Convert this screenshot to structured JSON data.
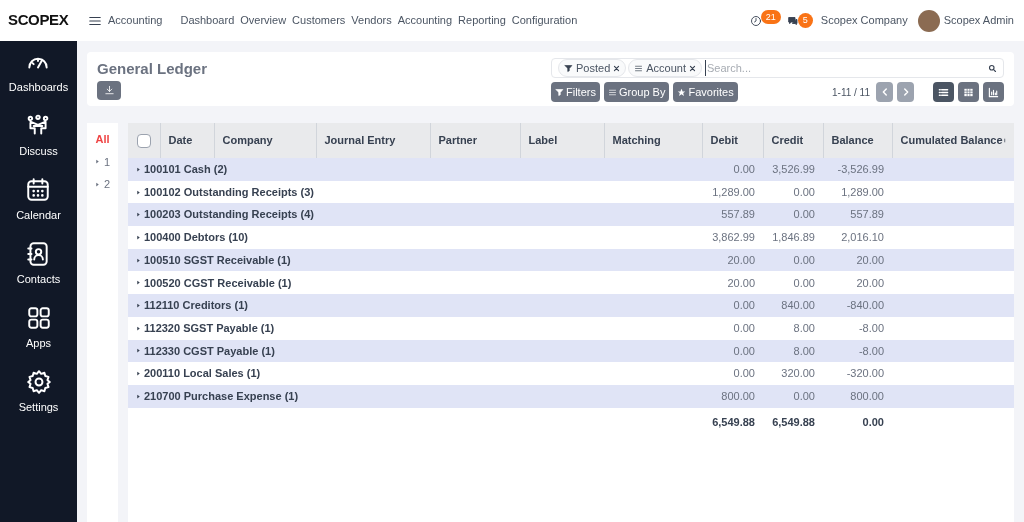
{
  "topbar": {
    "logo": "SCOPEX",
    "app": "Accounting",
    "menu": [
      "Dashboard",
      "Overview",
      "Customers",
      "Vendors",
      "Accounting",
      "Reporting",
      "Configuration"
    ],
    "activity_count": "21",
    "message_count": "5",
    "company": "Scopex Company",
    "user": "Scopex Admin"
  },
  "sidebar": {
    "items": [
      {
        "kind": "dashboards",
        "label": "Dashboards"
      },
      {
        "kind": "discuss",
        "label": "Discuss"
      },
      {
        "kind": "calendar",
        "label": "Calendar"
      },
      {
        "kind": "contacts",
        "label": "Contacts"
      },
      {
        "kind": "apps",
        "label": "Apps"
      },
      {
        "kind": "settings",
        "label": "Settings"
      }
    ]
  },
  "control_panel": {
    "title": "General Ledger",
    "facets": [
      {
        "kind": "filter",
        "label": "Posted"
      },
      {
        "kind": "group",
        "label": "Account"
      }
    ],
    "search": {
      "placeholder": "Search..."
    },
    "buttons": [
      {
        "kind": "filter",
        "label": "Filters"
      },
      {
        "kind": "group",
        "label": "Group By"
      },
      {
        "kind": "star",
        "label": "Favorites"
      }
    ],
    "pager": "1-11 / 11",
    "views": [
      {
        "kind": "list",
        "selected": true
      },
      {
        "kind": "grid",
        "selected": false
      },
      {
        "kind": "graph",
        "selected": false
      }
    ]
  },
  "levels": [
    {
      "label": "All",
      "selected": true,
      "expandable": false
    },
    {
      "label": "1",
      "selected": false,
      "expandable": true
    },
    {
      "label": "2",
      "selected": false,
      "expandable": true
    }
  ],
  "table": {
    "select_all": {
      "checked": false
    },
    "columns": [
      {
        "label": "Date",
        "sortable": false
      },
      {
        "label": "Company",
        "sortable": false
      },
      {
        "label": "Journal Entry",
        "sortable": false
      },
      {
        "label": "Partner",
        "sortable": false
      },
      {
        "label": "Label",
        "sortable": false
      },
      {
        "label": "Matching",
        "sortable": false
      },
      {
        "label": "Debit",
        "sortable": false
      },
      {
        "label": "Credit",
        "sortable": false
      },
      {
        "label": "Balance",
        "sortable": false
      },
      {
        "label": "Cumulated Balance",
        "sortable": true
      }
    ],
    "groups": [
      {
        "name": "100101 Cash (2)",
        "debit": "0.00",
        "credit": "3,526.99",
        "balance": "-3,526.99"
      },
      {
        "name": "100102 Outstanding Receipts (3)",
        "debit": "1,289.00",
        "credit": "0.00",
        "balance": "1,289.00"
      },
      {
        "name": "100203 Outstanding Receipts (4)",
        "debit": "557.89",
        "credit": "0.00",
        "balance": "557.89"
      },
      {
        "name": "100400 Debtors (10)",
        "debit": "3,862.99",
        "credit": "1,846.89",
        "balance": "2,016.10"
      },
      {
        "name": "100510 SGST Receivable (1)",
        "debit": "20.00",
        "credit": "0.00",
        "balance": "20.00"
      },
      {
        "name": "100520 CGST Receivable (1)",
        "debit": "20.00",
        "credit": "0.00",
        "balance": "20.00"
      },
      {
        "name": "112110 Creditors (1)",
        "debit": "0.00",
        "credit": "840.00",
        "balance": "-840.00"
      },
      {
        "name": "112320 SGST Payable (1)",
        "debit": "0.00",
        "credit": "8.00",
        "balance": "-8.00"
      },
      {
        "name": "112330 CGST Payable (1)",
        "debit": "0.00",
        "credit": "8.00",
        "balance": "-8.00"
      },
      {
        "name": "200110 Local Sales (1)",
        "debit": "0.00",
        "credit": "320.00",
        "balance": "-320.00"
      },
      {
        "name": "210700 Purchase Expense (1)",
        "debit": "800.00",
        "credit": "0.00",
        "balance": "800.00"
      }
    ],
    "totals": {
      "debit": "6,549.88",
      "credit": "6,549.88",
      "balance": "0.00"
    }
  }
}
